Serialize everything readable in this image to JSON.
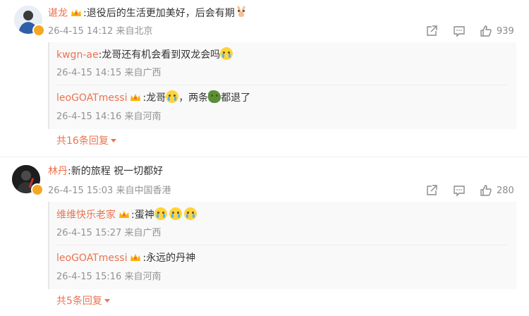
{
  "comments": [
    {
      "username": "谌龙",
      "text": "退役后的生活更加美好，后会有期",
      "time": "26-4-15 14:12",
      "location": "来自北京",
      "likes": "939",
      "replies": [
        {
          "username": "kwgn-ae",
          "text": "龙哥还有机会看到双龙会吗",
          "time": "26-4-15 14:15",
          "location": "来自广西"
        },
        {
          "username": "leoGOATmessi",
          "text_a": "龙哥",
          "text_b": "，两条",
          "text_c": "都退了",
          "time": "26-4-15 14:16",
          "location": "来自河南"
        }
      ],
      "more_label": "共16条回复"
    },
    {
      "username": "林丹",
      "text": "新的旅程 祝一切都好",
      "time": "26-4-15 15:03",
      "location": "来自中国香港",
      "likes": "280",
      "replies": [
        {
          "username": "维维快乐老家",
          "text": "蛋神",
          "time": "26-4-15 15:27",
          "location": "来自广西"
        },
        {
          "username": "leoGOATmessi",
          "text": "永远的丹神",
          "time": "26-4-15 15:16",
          "location": "来自河南"
        }
      ],
      "more_label": "共5条回复"
    }
  ],
  "colors": {
    "username": "#eb7350",
    "meta": "#939393",
    "badge": "#f5a623"
  },
  "icons": [
    "share-icon",
    "comment-icon",
    "like-icon",
    "crown-icon",
    "cry-emoji-icon",
    "victory-emoji-icon",
    "dragon-emoji-icon"
  ]
}
